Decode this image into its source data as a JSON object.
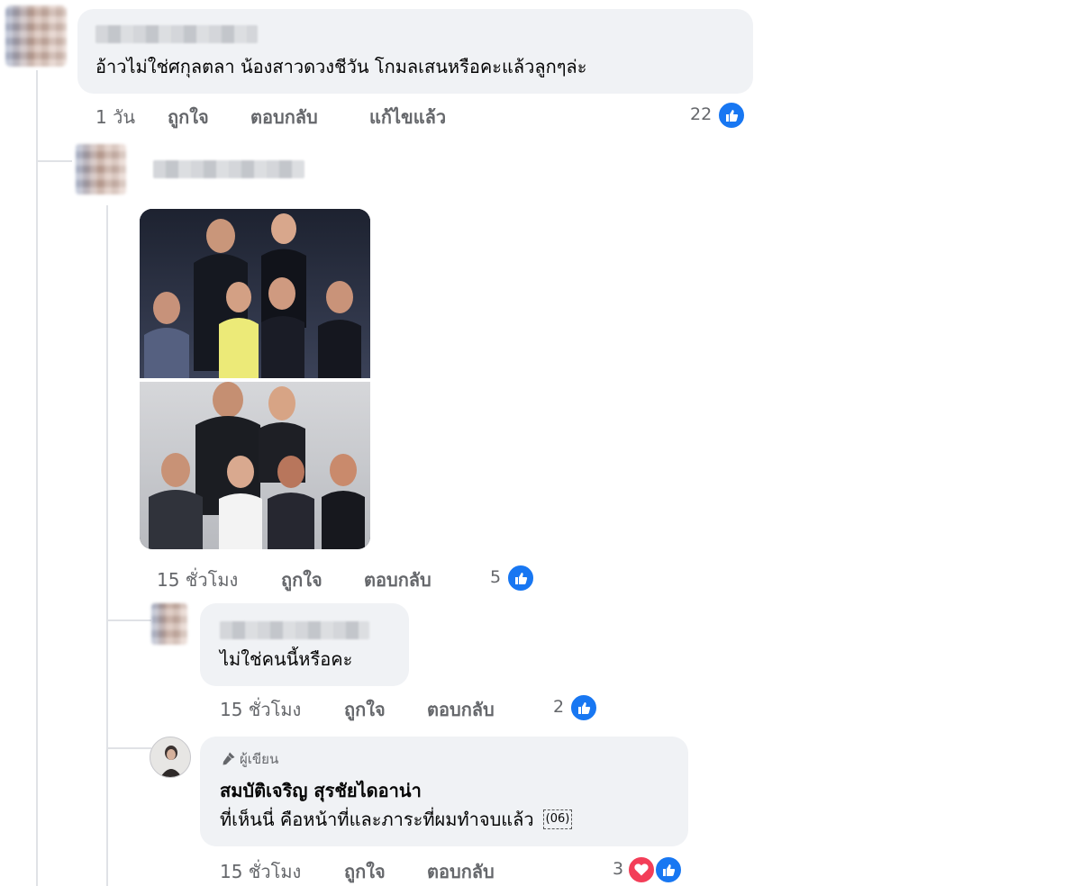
{
  "comment1": {
    "text": "อ้าวไม่ใช่ศกุลตลา น้องสาวดวงชีวัน โกมลเสนหรือคะแล้วลูกๆล่ะ",
    "time": "1 วัน",
    "like": "ถูกใจ",
    "reply": "ตอบกลับ",
    "edited": "แก้ไขแล้ว",
    "reactions": "22",
    "reaction_icon": "like-icon"
  },
  "reply1": {
    "image_description_icon": "photo-collage",
    "time": "15 ชั่วโมง",
    "like": "ถูกใจ",
    "reply": "ตอบกลับ",
    "reactions": "5",
    "reaction_icon": "like-icon"
  },
  "reply2": {
    "text": "ไม่ใช่คนนี้หรือคะ",
    "time": "15 ชั่วโมง",
    "like": "ถูกใจ",
    "reply": "ตอบกลับ",
    "reactions": "2",
    "reaction_icon": "like-icon"
  },
  "reply3": {
    "badge": "ผู้เขียน",
    "author": "สมบัติเจริญ สุรชัยไดอาน่า",
    "text": "ที่เห็นนี่ คือหน้าที่และภาระที่ผมทำจบแล้ว",
    "emoji_box": "(06)",
    "time": "15 ชั่วโมง",
    "like": "ถูกใจ",
    "reply": "ตอบกลับ",
    "reactions": "3",
    "reaction_icons": [
      "love-icon",
      "like-icon"
    ]
  },
  "colors": {
    "bubble": "#f0f2f5",
    "meta": "#65676b",
    "like_blue": "#1877f2",
    "love_red": "#f33e58",
    "thread_line": "#e0e2e6"
  }
}
